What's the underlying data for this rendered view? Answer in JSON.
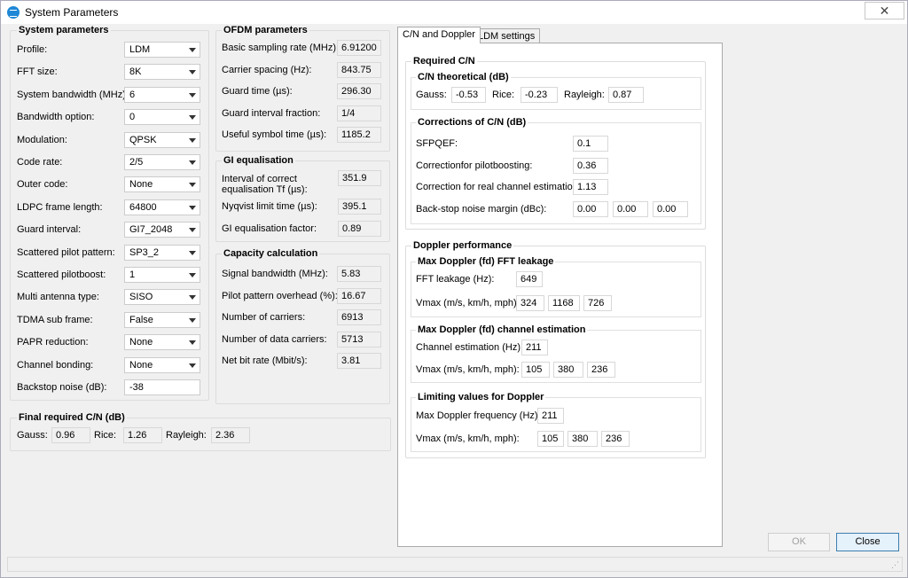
{
  "window": {
    "title": "System Parameters",
    "close": "✕"
  },
  "system": {
    "title": "System parameters",
    "rows": [
      {
        "label": "Profile:",
        "value": "LDM",
        "type": "combo"
      },
      {
        "label": "FFT size:",
        "value": "8K",
        "type": "combo"
      },
      {
        "label": "System bandwidth (MHz):",
        "value": "6",
        "type": "combo"
      },
      {
        "label": "Bandwidth option:",
        "value": "0",
        "type": "combo"
      },
      {
        "label": "Modulation:",
        "value": "QPSK",
        "type": "combo"
      },
      {
        "label": "Code rate:",
        "value": "2/5",
        "type": "combo"
      },
      {
        "label": "Outer code:",
        "value": "None",
        "type": "combo"
      },
      {
        "label": "LDPC frame length:",
        "value": "64800",
        "type": "combo"
      },
      {
        "label": "Guard interval:",
        "value": "GI7_2048",
        "type": "combo"
      },
      {
        "label": "Scattered pilot pattern:",
        "value": "SP3_2",
        "type": "combo"
      },
      {
        "label": "Scattered pilotboost:",
        "value": "1",
        "type": "combo"
      },
      {
        "label": "Multi antenna type:",
        "value": "SISO",
        "type": "combo"
      },
      {
        "label": "TDMA sub frame:",
        "value": "False",
        "type": "combo"
      },
      {
        "label": "PAPR reduction:",
        "value": "None",
        "type": "combo"
      },
      {
        "label": "Channel bonding:",
        "value": "None",
        "type": "combo"
      },
      {
        "label": "Backstop noise (dB):",
        "value": "-38",
        "type": "edit"
      }
    ]
  },
  "final": {
    "title": "Final required C/N (dB)",
    "gauss_label": "Gauss:",
    "gauss": "0.96",
    "rice_label": "Rice:",
    "rice": "1.26",
    "rayleigh_label": "Rayleigh:",
    "rayleigh": "2.36"
  },
  "ofdm": {
    "title": "OFDM parameters",
    "rows": [
      {
        "label": "Basic sampling rate (MHz):",
        "value": "6.91200"
      },
      {
        "label": "Carrier spacing (Hz):",
        "value": "843.75"
      },
      {
        "label": "Guard time (µs):",
        "value": "296.30"
      },
      {
        "label": "Guard interval fraction:",
        "value": "1/4"
      },
      {
        "label": "Useful symbol time (µs):",
        "value": "1185.2"
      }
    ]
  },
  "gi": {
    "title": "GI equalisation",
    "tf_label_1": "Interval of correct",
    "tf_label_2": "equalisation Tf (µs):",
    "tf": "351.9",
    "nyq_label": "Nyqvist limit time (µs):",
    "nyq": "395.1",
    "factor_label": "GI equalisation factor:",
    "factor": "0.89"
  },
  "capacity": {
    "title": "Capacity calculation",
    "rows": [
      {
        "label": "Signal bandwidth (MHz):",
        "value": "5.83"
      },
      {
        "label": "Pilot pattern overhead (%):",
        "value": "16.67"
      },
      {
        "label": "Number of carriers:",
        "value": "6913"
      },
      {
        "label": "Number of data carriers:",
        "value": "5713"
      },
      {
        "label": "Net bit rate (Mbit/s):",
        "value": "3.81"
      }
    ]
  },
  "tabs": [
    {
      "label": "C/N and Doppler"
    },
    {
      "label": "LDM settings"
    }
  ],
  "required_cn": {
    "title": "Required C/N",
    "theo_title": "C/N theoretical (dB)",
    "gauss_label": "Gauss:",
    "gauss": "-0.53",
    "rice_label": "Rice:",
    "rice": "-0.23",
    "rayleigh_label": "Rayleigh:",
    "rayleigh": "0.87",
    "corr_title": "Corrections of C/N (dB)",
    "sfpqef_label": "SFPQEF:",
    "sfpqef": "0.1",
    "pilot_label": "Correctionfor pilotboosting:",
    "pilot": "0.36",
    "realch_label": "Correction for real channel estimation:",
    "realch": "1.13",
    "backstop_label": "Back-stop noise margin (dBc):",
    "backstop": [
      "0.00",
      "0.00",
      "0.00"
    ]
  },
  "doppler": {
    "title": "Doppler performance",
    "fft_title": "Max Doppler (fd) FFT leakage",
    "fft_label": "FFT leakage (Hz):",
    "fft": "649",
    "fft_vmax_label": "Vmax (m/s, km/h, mph):",
    "fft_vmax": [
      "324",
      "1168",
      "726"
    ],
    "ch_title": "Max Doppler (fd) channel estimation",
    "ch_label": "Channel estimation (Hz):",
    "ch": "211",
    "ch_vmax_label": "Vmax (m/s, km/h, mph):",
    "ch_vmax": [
      "105",
      "380",
      "236"
    ],
    "lim_title": "Limiting values for Doppler",
    "lim_label": "Max Doppler frequency (Hz):",
    "lim": "211",
    "lim_vmax_label": "Vmax (m/s, km/h, mph):",
    "lim_vmax": [
      "105",
      "380",
      "236"
    ]
  },
  "buttons": {
    "ok": "OK",
    "close": "Close"
  }
}
